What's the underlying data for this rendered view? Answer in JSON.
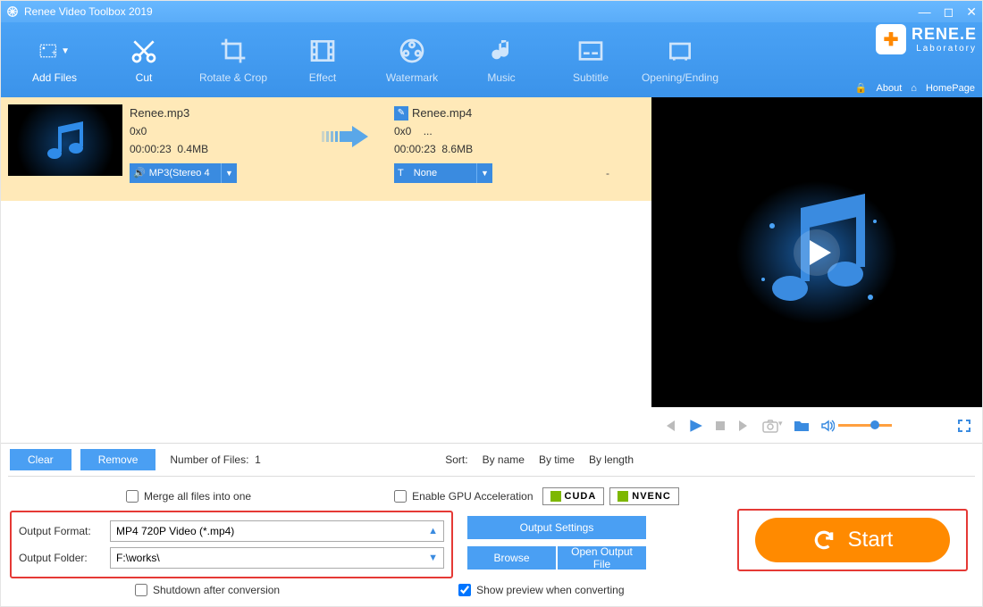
{
  "title": "Renee Video Toolbox 2019",
  "brand": {
    "line1": "RENE.E",
    "line2": "Laboratory",
    "about": "About",
    "homepage": "HomePage"
  },
  "toolbar": {
    "addFiles": "Add Files",
    "cut": "Cut",
    "rotate": "Rotate & Crop",
    "effect": "Effect",
    "watermark": "Watermark",
    "music": "Music",
    "subtitle": "Subtitle",
    "opening": "Opening/Ending"
  },
  "file": {
    "src": {
      "name": "Renee.mp3",
      "dim": "0x0",
      "dur": "00:00:23",
      "size": "0.4MB",
      "audio": "MP3(Stereo 4"
    },
    "dst": {
      "name": "Renee.mp4",
      "dim": "0x0",
      "more": "...",
      "dur": "00:00:23",
      "size": "8.6MB",
      "sub": "None",
      "other": "-"
    }
  },
  "listops": {
    "clear": "Clear",
    "remove": "Remove",
    "nfiles_lbl": "Number of Files:",
    "nfiles_val": "1",
    "sort_lbl": "Sort:",
    "by_name": "By name",
    "by_time": "By time",
    "by_length": "By length"
  },
  "settings": {
    "merge": "Merge all files into one",
    "gpu": "Enable GPU Acceleration",
    "cuda": "CUDA",
    "nvenc": "NVENC",
    "ofmt_lbl": "Output Format:",
    "ofmt_val": "MP4 720P Video (*.mp4)",
    "ofld_lbl": "Output Folder:",
    "ofld_val": "F:\\works\\",
    "out_settings": "Output Settings",
    "browse": "Browse",
    "open_out": "Open Output File",
    "shutdown": "Shutdown after conversion",
    "preview": "Show preview when converting",
    "start": "Start"
  }
}
